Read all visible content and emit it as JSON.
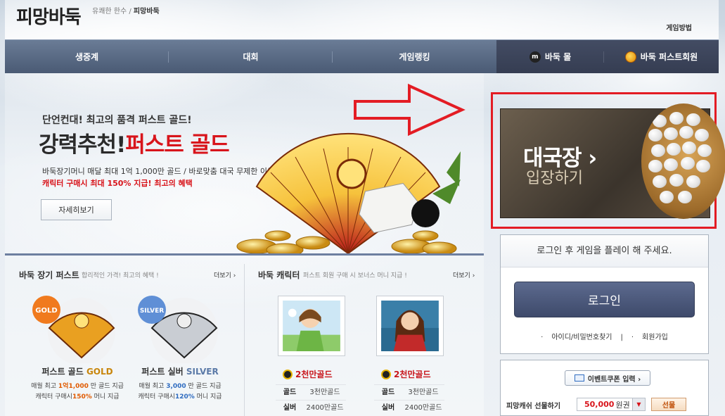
{
  "header": {
    "logo": "피망바둑",
    "slogan_prefix": "유쾌한 한수 /",
    "slogan_brand": "피망바둑",
    "howto": "게임방법"
  },
  "nav": {
    "items": [
      "생중계",
      "대회",
      "게임랭킹"
    ],
    "mall": "바둑 몰",
    "first": "바둑 퍼스트회원",
    "mall_icon_text": "m"
  },
  "promo": {
    "subtitle": "단언컨대! 최고의 품격 퍼스트 골드!",
    "title_black": "강력추천!",
    "title_red": "퍼스트 골드",
    "desc1": "바둑장기머니 매달 최대 1억 1,000만 골드 / 바로맞춤 대국 무제한 이용",
    "desc2": "캐릭터 구매시 최대 150% 지급! 최고의 혜택",
    "detail_button": "자세히보기"
  },
  "pass_section": {
    "title": "바둑 장기 퍼스트",
    "desc": "합리적인 가격! 최고의 혜택 !",
    "more": "더보기 ›",
    "items": [
      {
        "badge": "GOLD",
        "name": "퍼스트 골드",
        "grade": "GOLD",
        "d1a": "매월 최고 ",
        "d1b": "1억1,000",
        "d1c": " 만 골드 지급",
        "d2a": "캐릭터 구매시",
        "d2b": "150%",
        "d2c": " 머니 지급"
      },
      {
        "badge": "SILVER",
        "name": "퍼스트 실버",
        "grade": "SILVER",
        "d1a": "매월 최고 ",
        "d1b": "3,000",
        "d1c": " 만 골드 지급",
        "d2a": "캐릭터 구매시",
        "d2b": "120%",
        "d2c": " 머니 지급"
      }
    ]
  },
  "char_section": {
    "title": "바둑 캐릭터",
    "desc": "퍼스트 회원 구매 시 보너스 머니 지급 !",
    "more": "더보기 ›",
    "items": [
      {
        "price": "2천만골드",
        "gold_label": "골드",
        "gold_value": "3천만골드",
        "silver_label": "실버",
        "silver_value": "2400만골드"
      },
      {
        "price": "2천만골드",
        "gold_label": "골드",
        "gold_value": "3천만골드",
        "silver_label": "실버",
        "silver_value": "2400만골드"
      }
    ]
  },
  "enter": {
    "line1": "대국장 ›",
    "line2": "입장하기"
  },
  "login": {
    "message": "로그인 후 게임을 플레이 해 주세요.",
    "button": "로그인",
    "find": "아이디/비밀번호찾기",
    "join": "회원가입"
  },
  "coupon": {
    "button": "이벤트쿠폰 입력 ›",
    "gift_label": "피망캐쉬 선물하기",
    "gift_amount": "50,000",
    "gift_unit": "원권",
    "gift_button": "선물",
    "dropdown_icon": "chevron-down-icon"
  },
  "colors": {
    "accent_red": "#d8141b",
    "nav_bg": "#55657f",
    "highlight_border": "#e31c24"
  }
}
